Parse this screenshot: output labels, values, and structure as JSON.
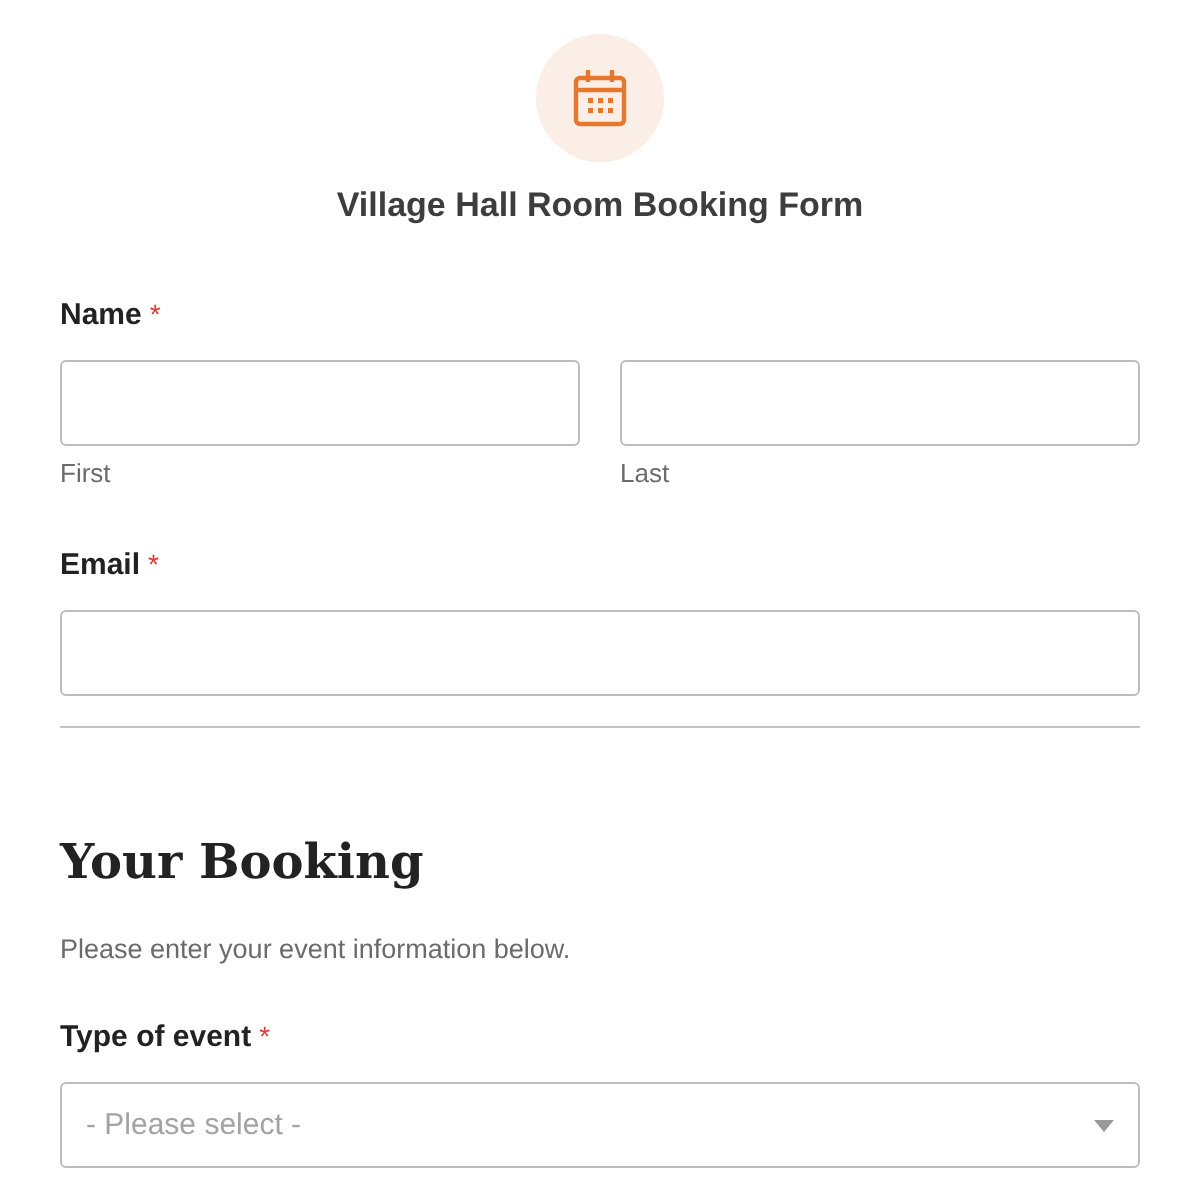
{
  "form": {
    "title": "Village Hall Room Booking Form"
  },
  "name_field": {
    "label": "Name",
    "required": true,
    "required_mark": "*",
    "parts": [
      {
        "sublabel": "First"
      },
      {
        "sublabel": "Last"
      }
    ]
  },
  "email_field": {
    "label": "Email",
    "required": true,
    "required_mark": "*"
  },
  "section": {
    "heading": "Your Booking",
    "description": "Please enter your event information below."
  },
  "event_field": {
    "label": "Type of event",
    "required": true,
    "required_mark": "*",
    "placeholder": "- Please select -"
  }
}
